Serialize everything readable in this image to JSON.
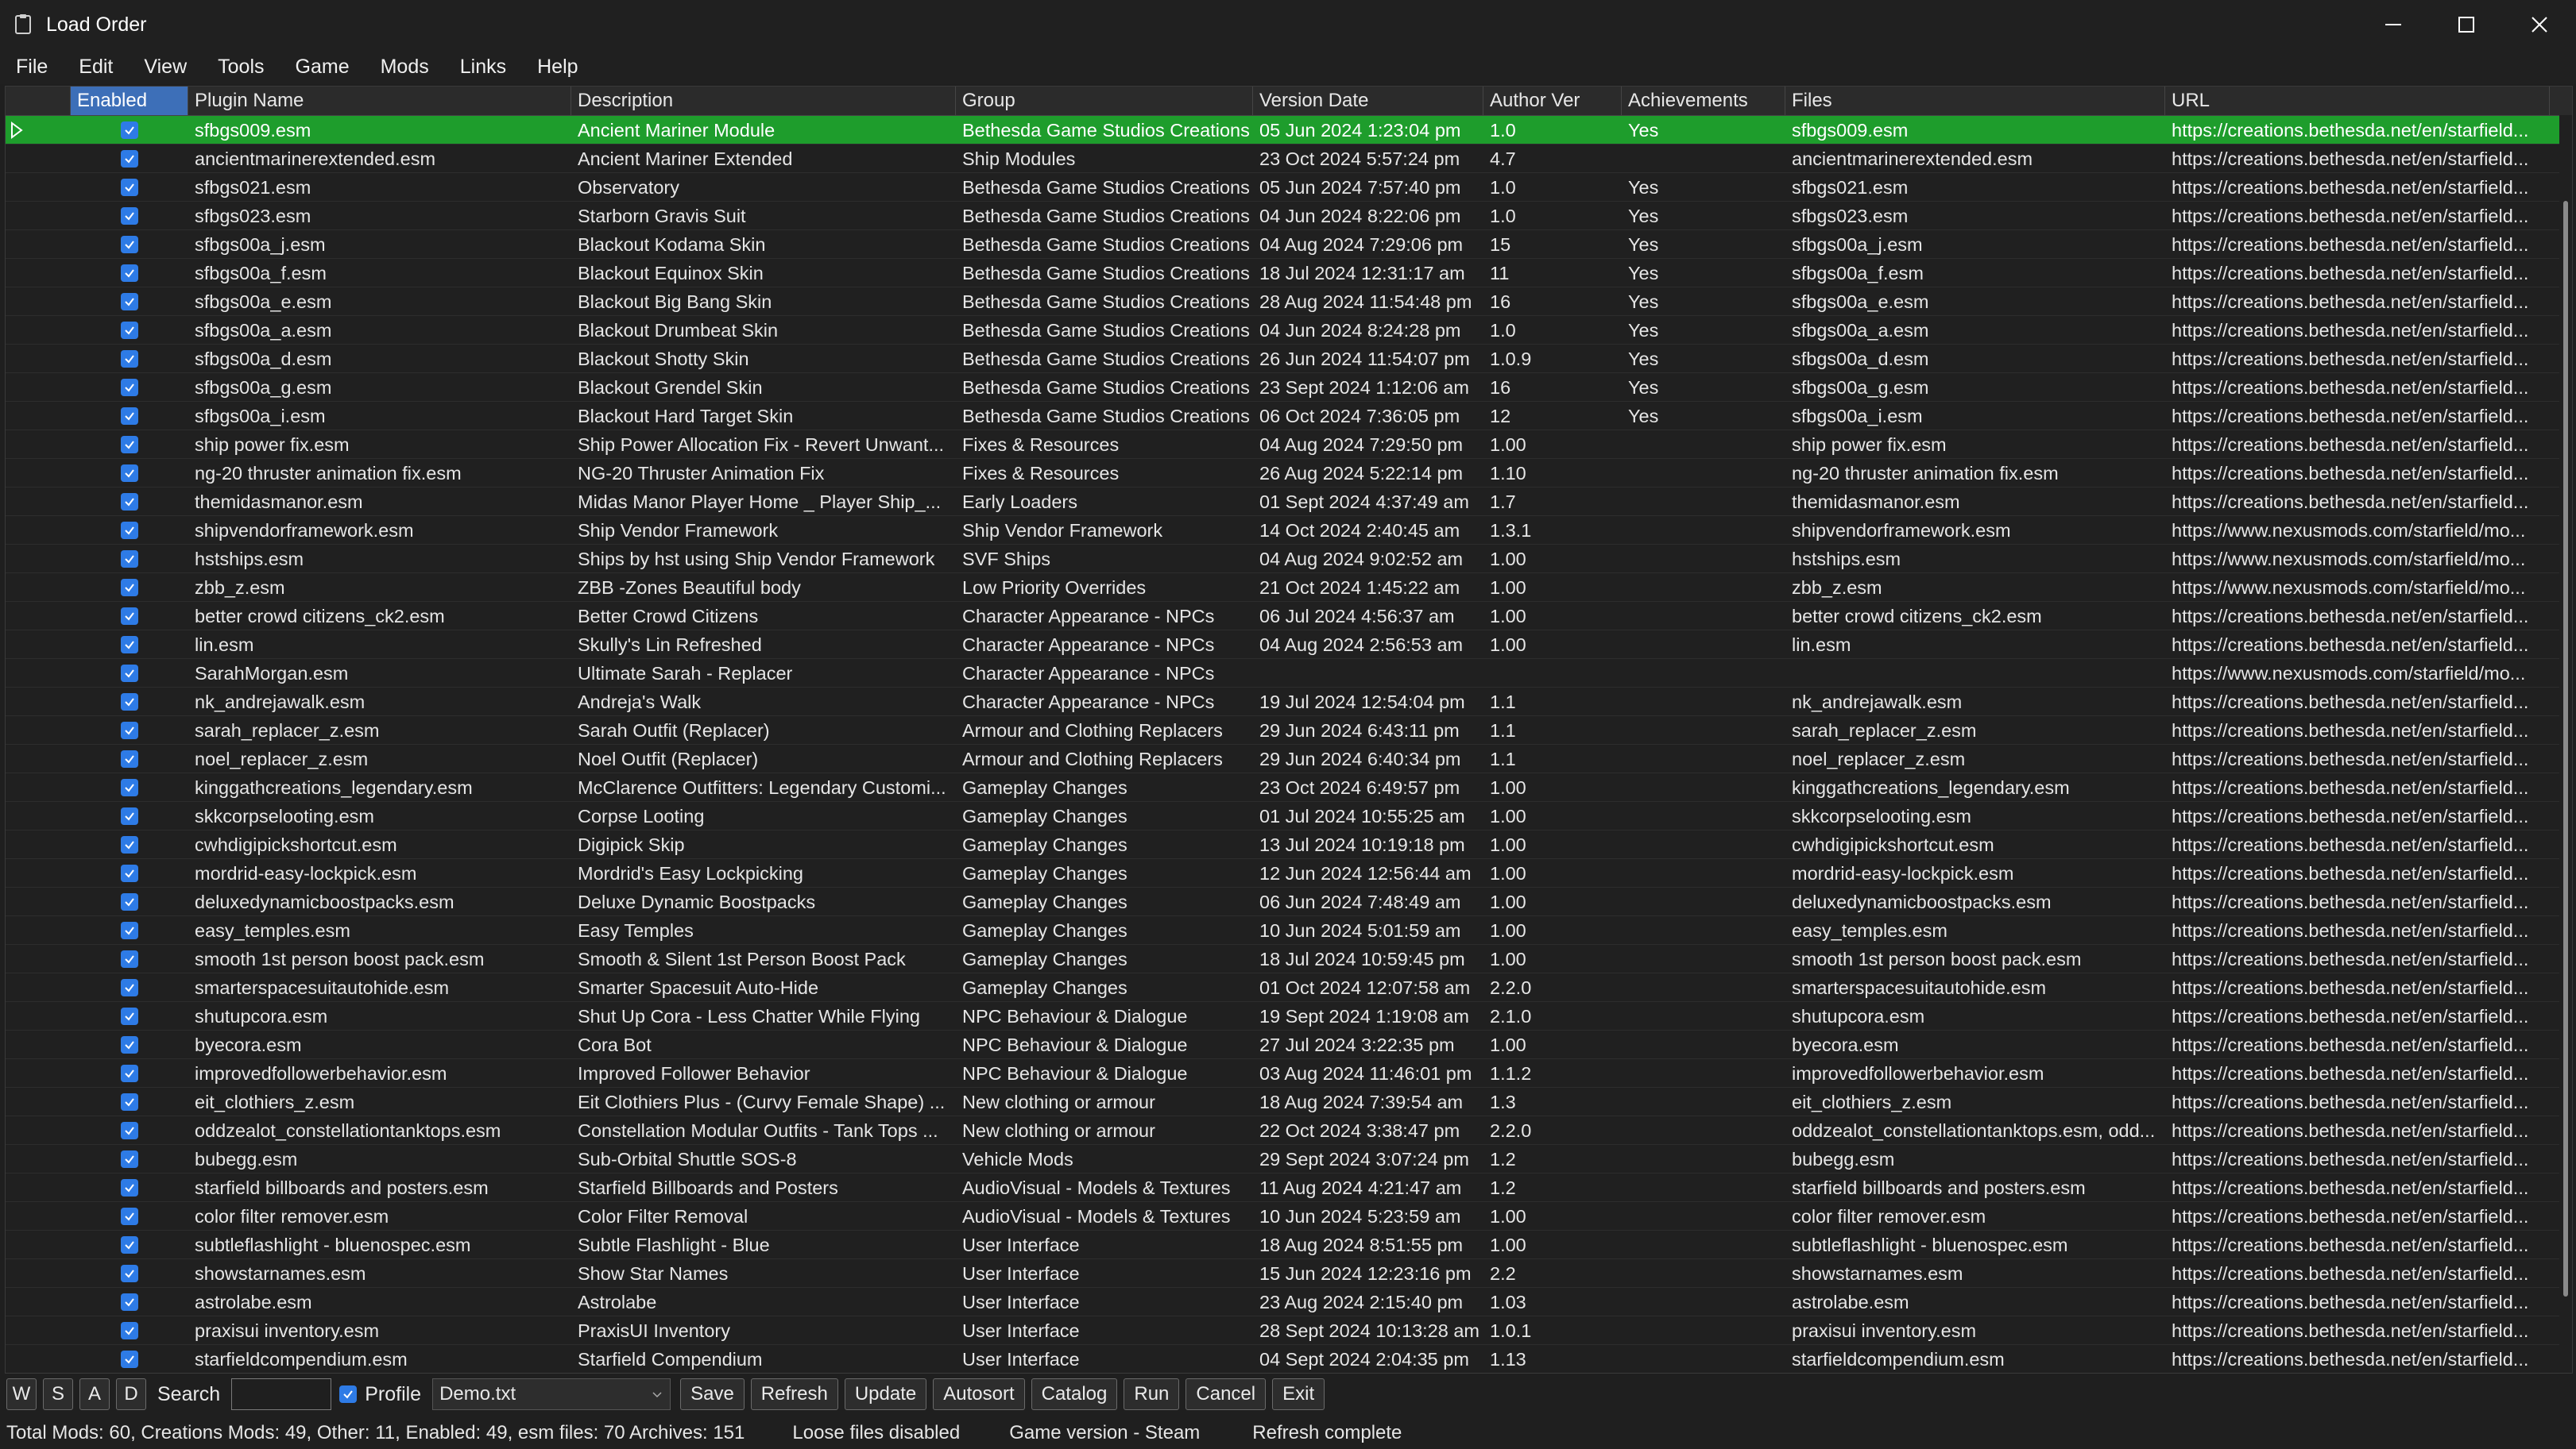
{
  "window": {
    "title": "Load Order"
  },
  "menu": [
    "File",
    "Edit",
    "View",
    "Tools",
    "Game",
    "Mods",
    "Links",
    "Help"
  ],
  "columns": [
    "",
    "Enabled",
    "Plugin Name",
    "Description",
    "Group",
    "Version Date",
    "Author Ver",
    "Achievements",
    "Files",
    "URL"
  ],
  "rows": [
    {
      "plugin": "sfbgs009.esm",
      "desc": "Ancient Mariner Module",
      "group": "Bethesda Game Studios Creations",
      "date": "05 Jun 2024 1:23:04 pm",
      "ver": "1.0",
      "ach": "Yes",
      "files": "sfbgs009.esm",
      "url": "https://creations.bethesda.net/en/starfield..."
    },
    {
      "plugin": "ancientmarinerextended.esm",
      "desc": "Ancient Mariner Extended",
      "group": "Ship Modules",
      "date": "23 Oct 2024 5:57:24 pm",
      "ver": "4.7",
      "ach": "",
      "files": "ancientmarinerextended.esm",
      "url": "https://creations.bethesda.net/en/starfield..."
    },
    {
      "plugin": "sfbgs021.esm",
      "desc": "Observatory",
      "group": "Bethesda Game Studios Creations",
      "date": "05 Jun 2024 7:57:40 pm",
      "ver": "1.0",
      "ach": "Yes",
      "files": "sfbgs021.esm",
      "url": "https://creations.bethesda.net/en/starfield..."
    },
    {
      "plugin": "sfbgs023.esm",
      "desc": "Starborn Gravis Suit",
      "group": "Bethesda Game Studios Creations",
      "date": "04 Jun 2024 8:22:06 pm",
      "ver": "1.0",
      "ach": "Yes",
      "files": "sfbgs023.esm",
      "url": "https://creations.bethesda.net/en/starfield..."
    },
    {
      "plugin": "sfbgs00a_j.esm",
      "desc": "Blackout Kodama Skin",
      "group": "Bethesda Game Studios Creations",
      "date": "04 Aug 2024 7:29:06 pm",
      "ver": "15",
      "ach": "Yes",
      "files": "sfbgs00a_j.esm",
      "url": "https://creations.bethesda.net/en/starfield..."
    },
    {
      "plugin": "sfbgs00a_f.esm",
      "desc": "Blackout Equinox Skin",
      "group": "Bethesda Game Studios Creations",
      "date": "18 Jul 2024 12:31:17 am",
      "ver": "11",
      "ach": "Yes",
      "files": "sfbgs00a_f.esm",
      "url": "https://creations.bethesda.net/en/starfield..."
    },
    {
      "plugin": "sfbgs00a_e.esm",
      "desc": "Blackout Big Bang Skin",
      "group": "Bethesda Game Studios Creations",
      "date": "28 Aug 2024 11:54:48 pm",
      "ver": "16",
      "ach": "Yes",
      "files": "sfbgs00a_e.esm",
      "url": "https://creations.bethesda.net/en/starfield..."
    },
    {
      "plugin": "sfbgs00a_a.esm",
      "desc": "Blackout Drumbeat Skin",
      "group": "Bethesda Game Studios Creations",
      "date": "04 Jun 2024 8:24:28 pm",
      "ver": "1.0",
      "ach": "Yes",
      "files": "sfbgs00a_a.esm",
      "url": "https://creations.bethesda.net/en/starfield..."
    },
    {
      "plugin": "sfbgs00a_d.esm",
      "desc": "Blackout Shotty Skin",
      "group": "Bethesda Game Studios Creations",
      "date": "26 Jun 2024 11:54:07 pm",
      "ver": "1.0.9",
      "ach": "Yes",
      "files": "sfbgs00a_d.esm",
      "url": "https://creations.bethesda.net/en/starfield..."
    },
    {
      "plugin": "sfbgs00a_g.esm",
      "desc": "Blackout Grendel Skin",
      "group": "Bethesda Game Studios Creations",
      "date": "23 Sept 2024 1:12:06 am",
      "ver": "16",
      "ach": "Yes",
      "files": "sfbgs00a_g.esm",
      "url": "https://creations.bethesda.net/en/starfield..."
    },
    {
      "plugin": "sfbgs00a_i.esm",
      "desc": "Blackout Hard Target Skin",
      "group": "Bethesda Game Studios Creations",
      "date": "06 Oct 2024 7:36:05 pm",
      "ver": "12",
      "ach": "Yes",
      "files": "sfbgs00a_i.esm",
      "url": "https://creations.bethesda.net/en/starfield..."
    },
    {
      "plugin": "ship power fix.esm",
      "desc": "Ship Power Allocation Fix - Revert Unwant...",
      "group": "Fixes & Resources",
      "date": "04 Aug 2024 7:29:50 pm",
      "ver": "1.00",
      "ach": "",
      "files": "ship power fix.esm",
      "url": "https://creations.bethesda.net/en/starfield..."
    },
    {
      "plugin": "ng-20 thruster animation fix.esm",
      "desc": "NG-20 Thruster Animation Fix",
      "group": "Fixes & Resources",
      "date": "26 Aug 2024 5:22:14 pm",
      "ver": "1.10",
      "ach": "",
      "files": "ng-20 thruster animation fix.esm",
      "url": "https://creations.bethesda.net/en/starfield..."
    },
    {
      "plugin": "themidasmanor.esm",
      "desc": "Midas Manor Player Home _ Player Ship_...",
      "group": "Early Loaders",
      "date": "01 Sept 2024 4:37:49 am",
      "ver": "1.7",
      "ach": "",
      "files": "themidasmanor.esm",
      "url": "https://creations.bethesda.net/en/starfield..."
    },
    {
      "plugin": "shipvendorframework.esm",
      "desc": "Ship Vendor Framework",
      "group": "Ship Vendor Framework",
      "date": "14 Oct 2024 2:40:45 am",
      "ver": "1.3.1",
      "ach": "",
      "files": "shipvendorframework.esm",
      "url": "https://www.nexusmods.com/starfield/mo..."
    },
    {
      "plugin": "hstships.esm",
      "desc": "Ships by hst using Ship Vendor Framework",
      "group": "SVF Ships",
      "date": "04 Aug 2024 9:02:52 am",
      "ver": "1.00",
      "ach": "",
      "files": "hstships.esm",
      "url": "https://www.nexusmods.com/starfield/mo..."
    },
    {
      "plugin": "zbb_z.esm",
      "desc": "ZBB -Zones Beautiful body",
      "group": "Low Priority Overrides",
      "date": "21 Oct 2024 1:45:22 am",
      "ver": "1.00",
      "ach": "",
      "files": "zbb_z.esm",
      "url": "https://www.nexusmods.com/starfield/mo..."
    },
    {
      "plugin": "better crowd citizens_ck2.esm",
      "desc": "Better Crowd Citizens",
      "group": "Character Appearance - NPCs",
      "date": "06 Jul 2024 4:56:37 am",
      "ver": "1.00",
      "ach": "",
      "files": "better crowd citizens_ck2.esm",
      "url": "https://creations.bethesda.net/en/starfield..."
    },
    {
      "plugin": "lin.esm",
      "desc": "Skully's Lin Refreshed",
      "group": "Character Appearance - NPCs",
      "date": "04 Aug 2024 2:56:53 am",
      "ver": "1.00",
      "ach": "",
      "files": "lin.esm",
      "url": "https://creations.bethesda.net/en/starfield..."
    },
    {
      "plugin": "SarahMorgan.esm",
      "desc": "Ultimate Sarah - Replacer",
      "group": "Character Appearance - NPCs",
      "date": "",
      "ver": "",
      "ach": "",
      "files": "",
      "url": "https://www.nexusmods.com/starfield/mo..."
    },
    {
      "plugin": "nk_andrejawalk.esm",
      "desc": "Andreja's Walk",
      "group": "Character Appearance - NPCs",
      "date": "19 Jul 2024 12:54:04 pm",
      "ver": "1.1",
      "ach": "",
      "files": "nk_andrejawalk.esm",
      "url": "https://creations.bethesda.net/en/starfield..."
    },
    {
      "plugin": "sarah_replacer_z.esm",
      "desc": "Sarah Outfit (Replacer)",
      "group": "Armour and Clothing Replacers",
      "date": "29 Jun 2024 6:43:11 pm",
      "ver": "1.1",
      "ach": "",
      "files": "sarah_replacer_z.esm",
      "url": "https://creations.bethesda.net/en/starfield..."
    },
    {
      "plugin": "noel_replacer_z.esm",
      "desc": "Noel Outfit (Replacer)",
      "group": "Armour and Clothing Replacers",
      "date": "29 Jun 2024 6:40:34 pm",
      "ver": "1.1",
      "ach": "",
      "files": "noel_replacer_z.esm",
      "url": "https://creations.bethesda.net/en/starfield..."
    },
    {
      "plugin": "kinggathcreations_legendary.esm",
      "desc": "McClarence Outfitters: Legendary Customi...",
      "group": "Gameplay Changes",
      "date": "23 Oct 2024 6:49:57 pm",
      "ver": "1.00",
      "ach": "",
      "files": "kinggathcreations_legendary.esm",
      "url": "https://creations.bethesda.net/en/starfield..."
    },
    {
      "plugin": "skkcorpselooting.esm",
      "desc": "Corpse Looting",
      "group": "Gameplay Changes",
      "date": "01 Jul 2024 10:55:25 am",
      "ver": "1.00",
      "ach": "",
      "files": "skkcorpselooting.esm",
      "url": "https://creations.bethesda.net/en/starfield..."
    },
    {
      "plugin": "cwhdigipickshortcut.esm",
      "desc": "Digipick Skip",
      "group": "Gameplay Changes",
      "date": "13 Jul 2024 10:19:18 pm",
      "ver": "1.00",
      "ach": "",
      "files": "cwhdigipickshortcut.esm",
      "url": "https://creations.bethesda.net/en/starfield..."
    },
    {
      "plugin": "mordrid-easy-lockpick.esm",
      "desc": "Mordrid's Easy Lockpicking",
      "group": "Gameplay Changes",
      "date": "12 Jun 2024 12:56:44 am",
      "ver": "1.00",
      "ach": "",
      "files": "mordrid-easy-lockpick.esm",
      "url": "https://creations.bethesda.net/en/starfield..."
    },
    {
      "plugin": "deluxedynamicboostpacks.esm",
      "desc": "Deluxe Dynamic Boostpacks",
      "group": "Gameplay Changes",
      "date": "06 Jun 2024 7:48:49 am",
      "ver": "1.00",
      "ach": "",
      "files": "deluxedynamicboostpacks.esm",
      "url": "https://creations.bethesda.net/en/starfield..."
    },
    {
      "plugin": "easy_temples.esm",
      "desc": "Easy Temples",
      "group": "Gameplay Changes",
      "date": "10 Jun 2024 5:01:59 am",
      "ver": "1.00",
      "ach": "",
      "files": "easy_temples.esm",
      "url": "https://creations.bethesda.net/en/starfield..."
    },
    {
      "plugin": "smooth 1st person boost pack.esm",
      "desc": "Smooth & Silent 1st Person Boost Pack",
      "group": "Gameplay Changes",
      "date": "18 Jul 2024 10:59:45 pm",
      "ver": "1.00",
      "ach": "",
      "files": "smooth 1st person boost pack.esm",
      "url": "https://creations.bethesda.net/en/starfield..."
    },
    {
      "plugin": "smarterspacesuitautohide.esm",
      "desc": "Smarter Spacesuit Auto-Hide",
      "group": "Gameplay Changes",
      "date": "01 Oct 2024 12:07:58 am",
      "ver": "2.2.0",
      "ach": "",
      "files": "smarterspacesuitautohide.esm",
      "url": "https://creations.bethesda.net/en/starfield..."
    },
    {
      "plugin": "shutupcora.esm",
      "desc": "Shut Up Cora - Less Chatter While Flying",
      "group": "NPC Behaviour & Dialogue",
      "date": "19 Sept 2024 1:19:08 am",
      "ver": "2.1.0",
      "ach": "",
      "files": "shutupcora.esm",
      "url": "https://creations.bethesda.net/en/starfield..."
    },
    {
      "plugin": "byecora.esm",
      "desc": "Cora Bot",
      "group": "NPC Behaviour & Dialogue",
      "date": "27 Jul 2024 3:22:35 pm",
      "ver": "1.00",
      "ach": "",
      "files": "byecora.esm",
      "url": "https://creations.bethesda.net/en/starfield..."
    },
    {
      "plugin": "improvedfollowerbehavior.esm",
      "desc": "Improved Follower Behavior",
      "group": "NPC Behaviour & Dialogue",
      "date": "03 Aug 2024 11:46:01 pm",
      "ver": "1.1.2",
      "ach": "",
      "files": "improvedfollowerbehavior.esm",
      "url": "https://creations.bethesda.net/en/starfield..."
    },
    {
      "plugin": "eit_clothiers_z.esm",
      "desc": "Eit Clothiers Plus - (Curvy Female Shape) ...",
      "group": "New clothing or armour",
      "date": "18 Aug 2024 7:39:54 am",
      "ver": "1.3",
      "ach": "",
      "files": "eit_clothiers_z.esm",
      "url": "https://creations.bethesda.net/en/starfield..."
    },
    {
      "plugin": "oddzealot_constellationtanktops.esm",
      "desc": "Constellation Modular Outfits - Tank Tops ...",
      "group": "New clothing or armour",
      "date": "22 Oct 2024 3:38:47 pm",
      "ver": "2.2.0",
      "ach": "",
      "files": "oddzealot_constellationtanktops.esm, odd...",
      "url": "https://creations.bethesda.net/en/starfield..."
    },
    {
      "plugin": "bubegg.esm",
      "desc": "Sub-Orbital Shuttle SOS-8",
      "group": "Vehicle Mods",
      "date": "29 Sept 2024 3:07:24 pm",
      "ver": "1.2",
      "ach": "",
      "files": "bubegg.esm",
      "url": "https://creations.bethesda.net/en/starfield..."
    },
    {
      "plugin": "starfield billboards and posters.esm",
      "desc": "Starfield Billboards and Posters",
      "group": "AudioVisual - Models & Textures",
      "date": "11 Aug 2024 4:21:47 am",
      "ver": "1.2",
      "ach": "",
      "files": "starfield billboards and posters.esm",
      "url": "https://creations.bethesda.net/en/starfield..."
    },
    {
      "plugin": "color filter remover.esm",
      "desc": "Color Filter Removal",
      "group": "AudioVisual - Models & Textures",
      "date": "10 Jun 2024 5:23:59 am",
      "ver": "1.00",
      "ach": "",
      "files": "color filter remover.esm",
      "url": "https://creations.bethesda.net/en/starfield..."
    },
    {
      "plugin": "subtleflashlight - bluenospec.esm",
      "desc": "Subtle Flashlight - Blue",
      "group": "User Interface",
      "date": "18 Aug 2024 8:51:55 pm",
      "ver": "1.00",
      "ach": "",
      "files": "subtleflashlight - bluenospec.esm",
      "url": "https://creations.bethesda.net/en/starfield..."
    },
    {
      "plugin": "showstarnames.esm",
      "desc": "Show Star Names",
      "group": "User Interface",
      "date": "15 Jun 2024 12:23:16 pm",
      "ver": "2.2",
      "ach": "",
      "files": "showstarnames.esm",
      "url": "https://creations.bethesda.net/en/starfield..."
    },
    {
      "plugin": "astrolabe.esm",
      "desc": "Astrolabe",
      "group": "User Interface",
      "date": "23 Aug 2024 2:15:40 pm",
      "ver": "1.03",
      "ach": "",
      "files": "astrolabe.esm",
      "url": "https://creations.bethesda.net/en/starfield..."
    },
    {
      "plugin": "praxisui inventory.esm",
      "desc": "PraxisUI Inventory",
      "group": "User Interface",
      "date": "28 Sept 2024 10:13:28 am",
      "ver": "1.0.1",
      "ach": "",
      "files": "praxisui inventory.esm",
      "url": "https://creations.bethesda.net/en/starfield..."
    },
    {
      "plugin": "starfieldcompendium.esm",
      "desc": "Starfield Compendium",
      "group": "User Interface",
      "date": "04 Sept 2024 2:04:35 pm",
      "ver": "1.13",
      "ach": "",
      "files": "starfieldcompendium.esm",
      "url": "https://creations.bethesda.net/en/starfield..."
    }
  ],
  "current_row": 0,
  "toolbar": {
    "w": "W",
    "s": "S",
    "a": "A",
    "d": "D",
    "search_label": "Search",
    "search_value": "",
    "profile_label": "Profile",
    "profile_checked": true,
    "profile_value": "Demo.txt",
    "save": "Save",
    "refresh": "Refresh",
    "update": "Update",
    "autosort": "Autosort",
    "catalog": "Catalog",
    "run": "Run",
    "cancel": "Cancel",
    "exit": "Exit"
  },
  "status": {
    "counts": "Total Mods: 60, Creations Mods: 49, Other: 11, Enabled: 49, esm files: 70 Archives: 151",
    "loose": "Loose files disabled",
    "game_version": "Game version - Steam",
    "message": "Refresh complete"
  },
  "colors": {
    "current_row": "#1e9d2c",
    "header_selected": "#3d6fb8",
    "checkbox": "#2e7be6"
  }
}
